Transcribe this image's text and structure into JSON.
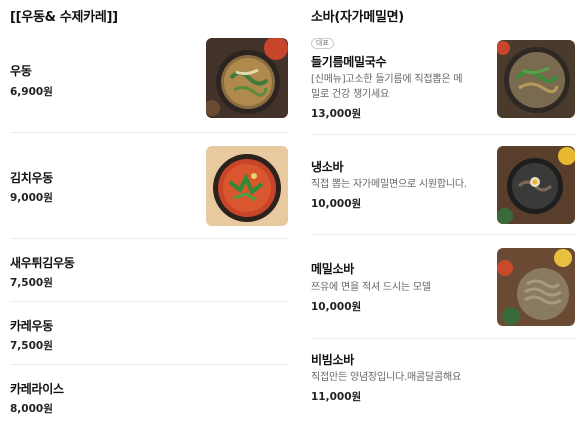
{
  "left": {
    "title": "[[우동& 수제카레]]",
    "items": [
      {
        "name": "우동",
        "price": "6,900원",
        "image": "udon-photo"
      },
      {
        "name": "김치우동",
        "price": "9,000원",
        "image": "kimchi-udon-photo"
      },
      {
        "name": "새우튀김우동",
        "price": "7,500원"
      },
      {
        "name": "카레우동",
        "price": "7,500원"
      },
      {
        "name": "카레라이스",
        "price": "8,000원"
      }
    ]
  },
  "right": {
    "title": "소바(자가메밀면)",
    "items": [
      {
        "badge": "대표",
        "name": "들기름메밀국수",
        "desc_line1": "[신메뉴]고소한 들기름에 직접뽑은 메",
        "desc_line2": "밀로 건강 챙기세요",
        "price": "13,000원",
        "image": "perilla-soba-photo"
      },
      {
        "name": "냉소바",
        "desc_line1": "직접 뽑는 자가메밀면으로 시원합니다.",
        "price": "10,000원",
        "image": "cold-soba-photo"
      },
      {
        "name": "메밀소바",
        "desc_line1": "쯔유에 면을 적셔 드시는 모델",
        "price": "10,000원",
        "image": "zaru-soba-photo"
      },
      {
        "name": "비빔소바",
        "desc_line1": "직접만든 양념장입니다.매콤달콤해요",
        "price": "11,000원"
      }
    ]
  }
}
